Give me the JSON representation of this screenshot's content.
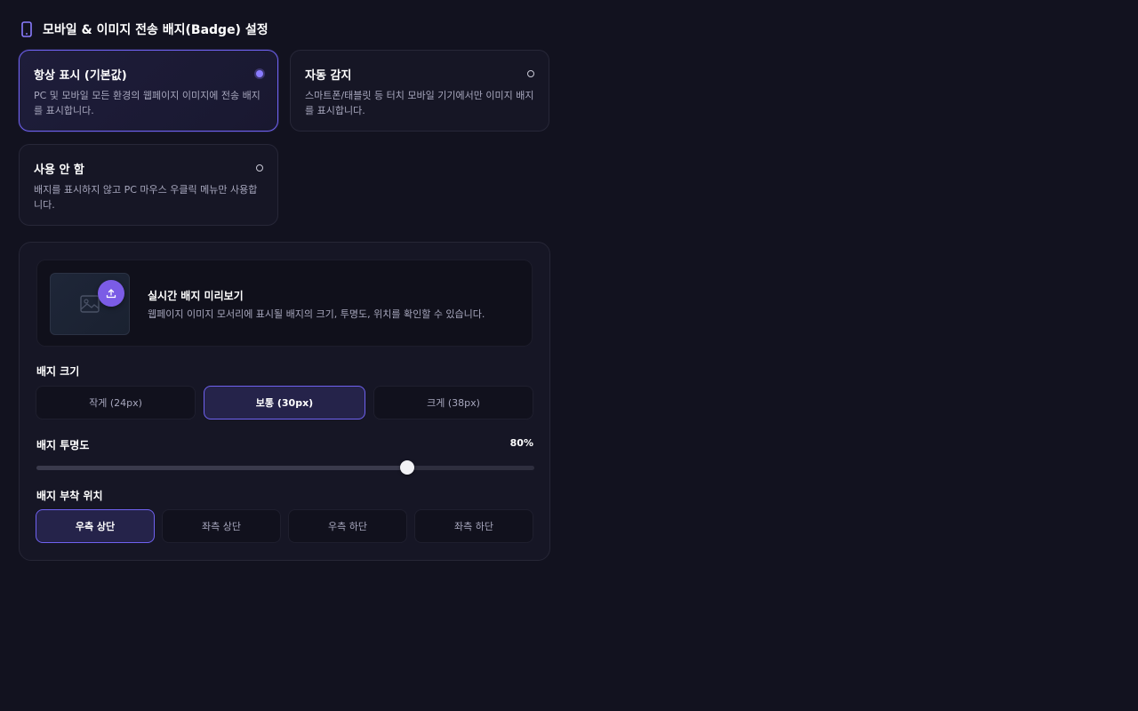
{
  "header": {
    "title": "모바일 & 이미지 전송 배지(Badge) 설정",
    "icon": "phone-icon"
  },
  "display_options": [
    {
      "title": "항상 표시 (기본값)",
      "desc": "PC 및 모바일 모든 환경의 웹페이지 이미지에 전송 배지를 표시합니다.",
      "selected": true
    },
    {
      "title": "자동 감지",
      "desc": "스마트폰/태블릿 등 터치 모바일 기기에서만 이미지 배지를 표시합니다.",
      "selected": false
    },
    {
      "title": "사용 안 함",
      "desc": "배지를 표시하지 않고 PC 마우스 우클릭 메뉴만 사용합니다.",
      "selected": false
    }
  ],
  "preview": {
    "title": "실시간 배지 미리보기",
    "desc": "웹페이지 이미지 모서리에 표시될 배지의 크기, 투명도, 위치를 확인할 수 있습니다."
  },
  "size": {
    "label": "배지 크기",
    "options": [
      "작게 (24px)",
      "보통 (30px)",
      "크게 (38px)"
    ],
    "selected_index": 1
  },
  "opacity": {
    "label": "배지 투명도",
    "value_text": "80%",
    "value": 80,
    "min": 0,
    "max": 100
  },
  "position": {
    "label": "배지 부착 위치",
    "options": [
      "우측 상단",
      "좌측 상단",
      "우측 하단",
      "좌측 하단"
    ],
    "selected_index": 0
  },
  "colors": {
    "accent": "#6f62f0",
    "badge": "#7b5ce6",
    "background": "#12121f"
  }
}
